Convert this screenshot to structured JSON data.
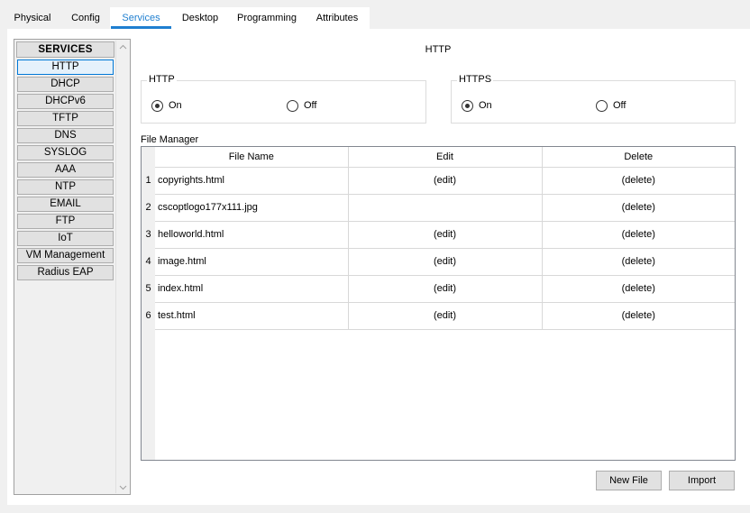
{
  "tabs": [
    {
      "label": "Physical"
    },
    {
      "label": "Config"
    },
    {
      "label": "Services"
    },
    {
      "label": "Desktop"
    },
    {
      "label": "Programming"
    },
    {
      "label": "Attributes"
    }
  ],
  "active_tab": "Services",
  "services": {
    "header": "SERVICES",
    "items": [
      {
        "label": "HTTP"
      },
      {
        "label": "DHCP"
      },
      {
        "label": "DHCPv6"
      },
      {
        "label": "TFTP"
      },
      {
        "label": "DNS"
      },
      {
        "label": "SYSLOG"
      },
      {
        "label": "AAA"
      },
      {
        "label": "NTP"
      },
      {
        "label": "EMAIL"
      },
      {
        "label": "FTP"
      },
      {
        "label": "IoT"
      },
      {
        "label": "VM Management"
      },
      {
        "label": "Radius EAP"
      }
    ],
    "selected": "HTTP"
  },
  "page_title": "HTTP",
  "http": {
    "label": "HTTP",
    "on_label": "On",
    "off_label": "Off",
    "value": "On"
  },
  "https": {
    "label": "HTTPS",
    "on_label": "On",
    "off_label": "Off",
    "value": "On"
  },
  "file_manager": {
    "label": "File Manager",
    "columns": [
      "File Name",
      "Edit",
      "Delete"
    ],
    "rows": [
      {
        "num": "1",
        "name": "copyrights.html",
        "edit": "(edit)",
        "delete": "(delete)"
      },
      {
        "num": "2",
        "name": "cscoptlogo177x111.jpg",
        "edit": "",
        "delete": "(delete)"
      },
      {
        "num": "3",
        "name": "helloworld.html",
        "edit": "(edit)",
        "delete": "(delete)"
      },
      {
        "num": "4",
        "name": "image.html",
        "edit": "(edit)",
        "delete": "(delete)"
      },
      {
        "num": "5",
        "name": "index.html",
        "edit": "(edit)",
        "delete": "(delete)"
      },
      {
        "num": "6",
        "name": "test.html",
        "edit": "(edit)",
        "delete": "(delete)"
      }
    ]
  },
  "buttons": {
    "new_file": "New File",
    "import": "Import"
  }
}
